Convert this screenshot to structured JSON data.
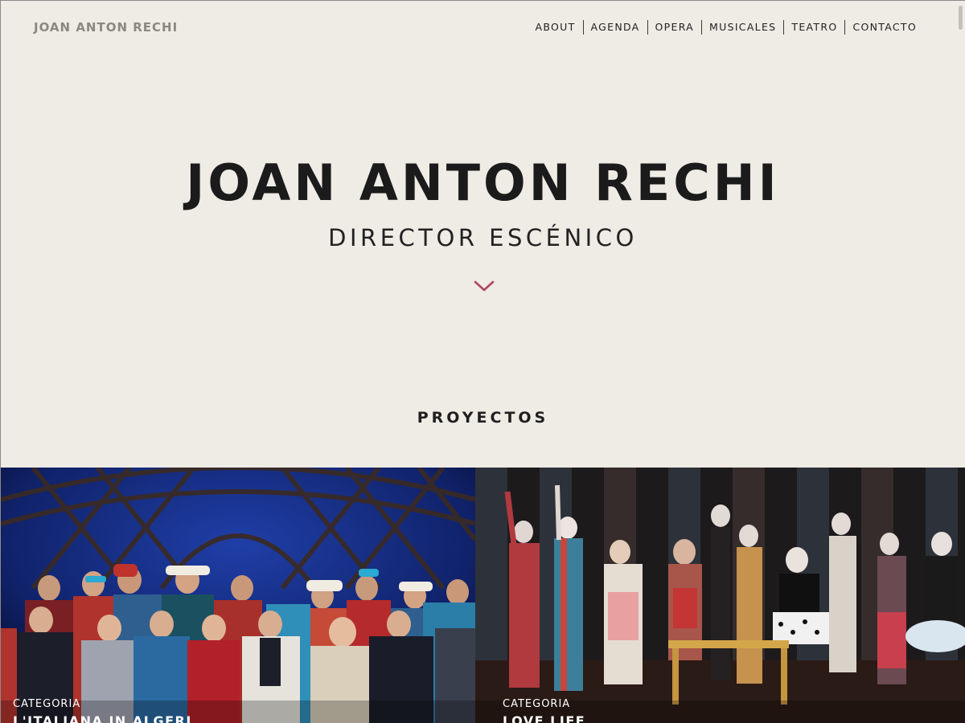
{
  "header": {
    "logo": "JOAN ANTON RECHI",
    "nav": [
      {
        "label": "ABOUT"
      },
      {
        "label": "AGENDA"
      },
      {
        "label": "OPERA"
      },
      {
        "label": "MUSICALES"
      },
      {
        "label": "TEATRO"
      },
      {
        "label": "CONTACTO"
      }
    ]
  },
  "hero": {
    "title": "JOAN ANTON RECHI",
    "subtitle": "DIRECTOR ESCÉNICO",
    "scroll_icon": "chevron-down-icon",
    "accent_color": "#b0455e"
  },
  "projects": {
    "title": "PROYECTOS",
    "items": [
      {
        "category": "CATEGORIA",
        "name": "L'ITALIANA IN ALGERI"
      },
      {
        "category": "CATEGORIA",
        "name": "LOVE LIFE"
      }
    ]
  },
  "colors": {
    "background": "#efebe5",
    "text": "#1c1c1c",
    "logo": "#8b8781"
  }
}
